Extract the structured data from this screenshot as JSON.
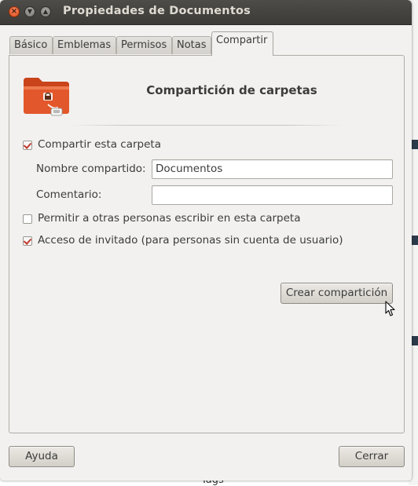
{
  "window": {
    "title": "Propiedades de Documentos"
  },
  "tabs": [
    {
      "label": "Básico",
      "active": false
    },
    {
      "label": "Emblemas",
      "active": false
    },
    {
      "label": "Permisos",
      "active": false
    },
    {
      "label": "Notas",
      "active": false
    },
    {
      "label": "Compartir",
      "active": true
    }
  ],
  "share": {
    "icon": "folder-share-icon",
    "heading": "Compartición de carpetas",
    "share_folder": {
      "label": "Compartir esta carpeta",
      "checked": true
    },
    "share_name": {
      "label": "Nombre compartido:",
      "value": "Documentos"
    },
    "comment": {
      "label": "Comentario:",
      "value": ""
    },
    "allow_write": {
      "label": "Permitir a otras personas escribir en esta carpeta",
      "checked": false
    },
    "guest_access": {
      "label": "Acceso de invitado (para personas sin cuenta de usuario)",
      "checked": true
    },
    "create_button": "Crear compartición"
  },
  "footer": {
    "help_button": "Ayuda",
    "close_button": "Cerrar"
  },
  "background": {
    "partial_text": "Tags"
  },
  "colors": {
    "titlebar": "#3c3b37",
    "close_button": "#df4a18",
    "checkmark": "#c0392b",
    "folder": "#e2572b"
  }
}
